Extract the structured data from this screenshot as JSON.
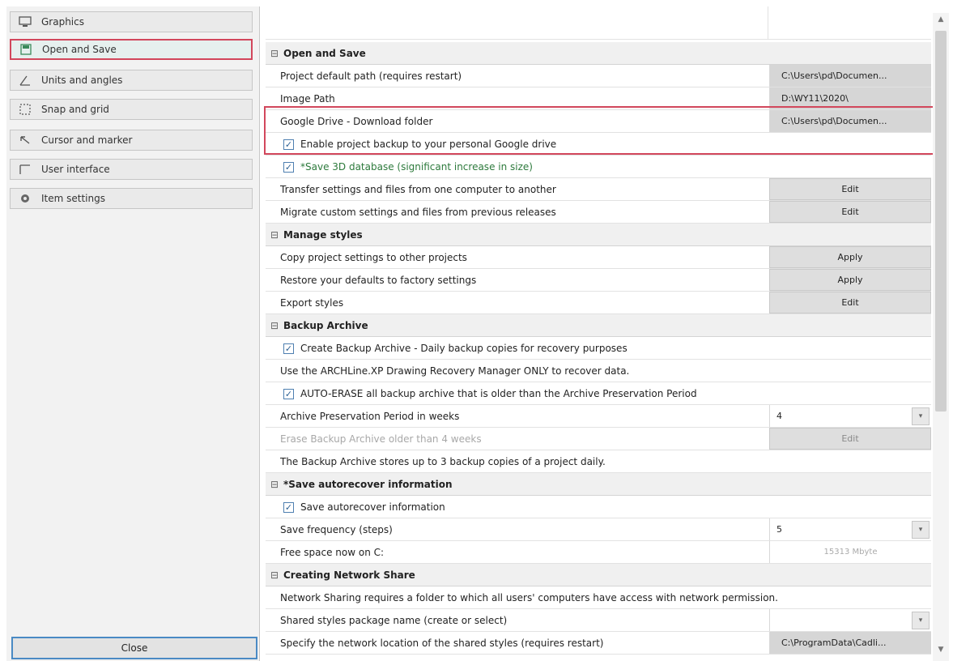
{
  "sidebar": {
    "items": [
      {
        "label": "Graphics",
        "icon": "monitor-icon"
      },
      {
        "label": "Open and Save",
        "icon": "folder-save-icon",
        "active": true
      },
      {
        "label": "Units and angles",
        "icon": "angle-icon"
      },
      {
        "label": "Snap and grid",
        "icon": "grid-icon"
      },
      {
        "label": "Cursor and marker",
        "icon": "cursor-icon"
      },
      {
        "label": "User interface",
        "icon": "window-icon"
      },
      {
        "label": "Item settings",
        "icon": "gear-icon"
      }
    ],
    "close_label": "Close"
  },
  "sections": {
    "open_save": "Open and Save",
    "manage_styles": "Manage styles",
    "backup_archive": "Backup Archive",
    "autorecover": "*Save autorecover information",
    "network_share": "Creating Network Share"
  },
  "rows": {
    "project_path_label": "Project default path (requires restart)",
    "project_path_value": "C:\\Users\\pd\\Documen...",
    "image_path_label": "Image Path",
    "image_path_value": "D:\\WY11\\2020\\",
    "gdrive_label": "Google Drive - Download folder",
    "gdrive_value": "C:\\Users\\pd\\Documen...",
    "enable_backup_label": "Enable project backup to your personal Google drive",
    "save_3d_label": "*Save 3D database (significant increase in size)",
    "transfer_label": "Transfer settings and files from one computer to another",
    "transfer_btn": "Edit",
    "migrate_label": "Migrate custom settings and files from previous releases",
    "migrate_btn": "Edit",
    "copy_settings_label": "Copy project settings to other projects",
    "copy_settings_btn": "Apply",
    "restore_label": "Restore your defaults to factory settings",
    "restore_btn": "Apply",
    "export_label": "Export styles",
    "export_btn": "Edit",
    "create_backup_label": "Create Backup Archive - Daily backup copies for recovery purposes",
    "recovery_note": "Use the ARCHLine.XP Drawing Recovery Manager ONLY to recover data.",
    "auto_erase_label": "AUTO-ERASE all backup archive that is older than the Archive Preservation Period",
    "preservation_label": "Archive Preservation Period in weeks",
    "preservation_value": "4",
    "erase_older_label": "Erase Backup Archive older than 4 weeks",
    "erase_older_btn": "Edit",
    "backup_note": "The Backup Archive stores up to 3 backup copies of a project daily.",
    "save_autorecover_label": "Save autorecover information",
    "frequency_label": "Save frequency (steps)",
    "frequency_value": "5",
    "free_space_label": "Free space now on C:",
    "free_space_value": "15313 Mbyte",
    "network_note": "Network Sharing requires a folder to which all users' computers have access with network permission.",
    "shared_pkg_label": "Shared styles package name (create or select)",
    "shared_pkg_value": "",
    "network_location_label": "Specify the network location of the shared styles (requires restart)",
    "network_location_value": "C:\\ProgramData\\Cadli..."
  }
}
